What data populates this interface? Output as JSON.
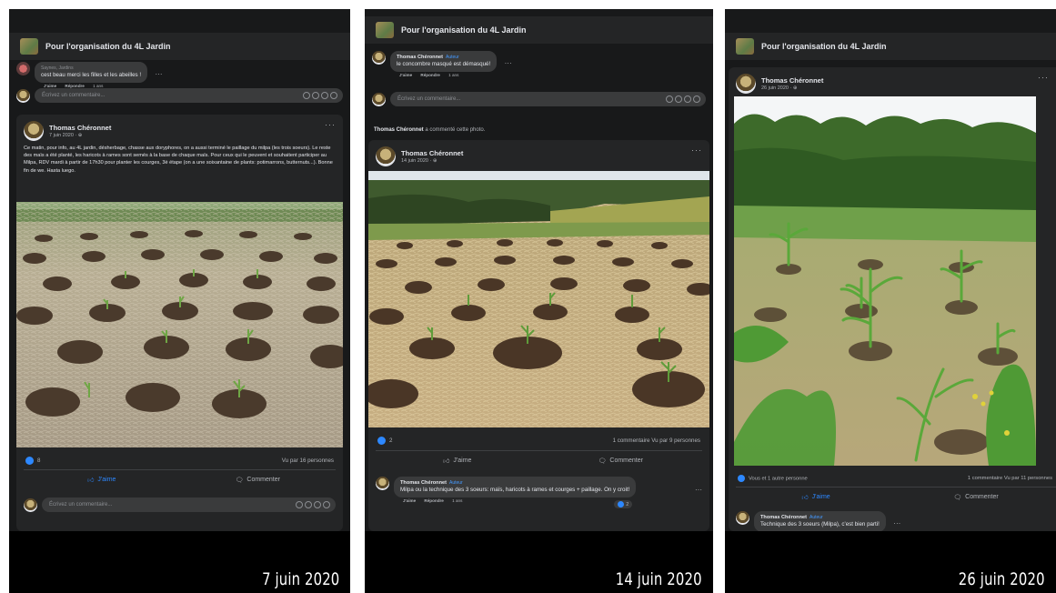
{
  "group_name": "Pour l'organisation du 4L Jardin",
  "panels": [
    {
      "caption": "7 juin 2020",
      "top_comment": {
        "text_faded": "Saynes, Jardins",
        "text": "cest beau merci les filles et les abeilles !",
        "actions": [
          "J'aime",
          "Répondre",
          "1 ans"
        ]
      },
      "comment_placeholder": "Écrivez un commentaire...",
      "post": {
        "author": "Thomas Chéronnet",
        "date": "7 juin 2020 · ⊕",
        "text": "Ce matin, pour info, au 4L jardin, désherbage, chasse aux doryphores, on a aussi terminé le paillage du milpa (les trois soeurs). Le reste des maïs a été planté, les haricots à rames sont semés à la base de chaque maïs. Pour ceux qui le peuvent et  souhaitent participer au Milpa, RDV mardi à partir de 17h30 pour planter les courges, 3è étape (on a une soixantaine de plants: potimarrons, butternuts...). Bonne fin de we. Hasta luego.",
        "likes": "8",
        "views": "Vu par 16 personnes",
        "like_label": "J'aime",
        "comment_label": "Commenter"
      }
    },
    {
      "caption": "14 juin 2020",
      "top_comment": {
        "name": "Thomas Chéronnet",
        "badge": "Auteur",
        "text": "le concombre masqué est démasqué!",
        "actions": [
          "J'aime",
          "Répondre",
          "1 ans"
        ]
      },
      "comment_placeholder": "Écrivez un commentaire...",
      "activity_name": "Thomas Chéronnet",
      "activity_text": " a commenté cette photo.",
      "post": {
        "author": "Thomas Chéronnet",
        "date": "14 juin 2020 · ⊕",
        "likes": "2",
        "views": "1 commentaire  Vu par 9 personnes",
        "like_label": "J'aime",
        "comment_label": "Commenter"
      },
      "bottom_comment": {
        "name": "Thomas Chéronnet",
        "badge": "Auteur",
        "text": "Milpa ou la technique des 3 soeurs: maïs, haricots à rames et courges + paillage. On y croit!",
        "actions": [
          "J'aime",
          "Répondre",
          "1 ans"
        ],
        "reaction": "2"
      }
    },
    {
      "caption": "26 juin 2020",
      "post": {
        "author": "Thomas Chéronnet",
        "date": "26 juin 2020 · ⊕",
        "likes": "Vous et 1 autre personne",
        "views": "1 commentaire  Vu par 11 personnes",
        "like_label": "J'aime",
        "comment_label": "Commenter"
      },
      "bottom_comment": {
        "name": "Thomas Chéronnet",
        "badge": "Auteur",
        "text": "Technique des 3 soeurs (Milpa), c'est bien parti!"
      }
    }
  ],
  "icons": {
    "like": "thumbs-up-icon",
    "comment": "speech-bubble-icon",
    "more": "more-dots-icon",
    "globe": "globe-icon"
  },
  "colors": {
    "facebook_blue": "#2d88ff",
    "dark_bg": "#18191a",
    "card_bg": "#242526"
  }
}
